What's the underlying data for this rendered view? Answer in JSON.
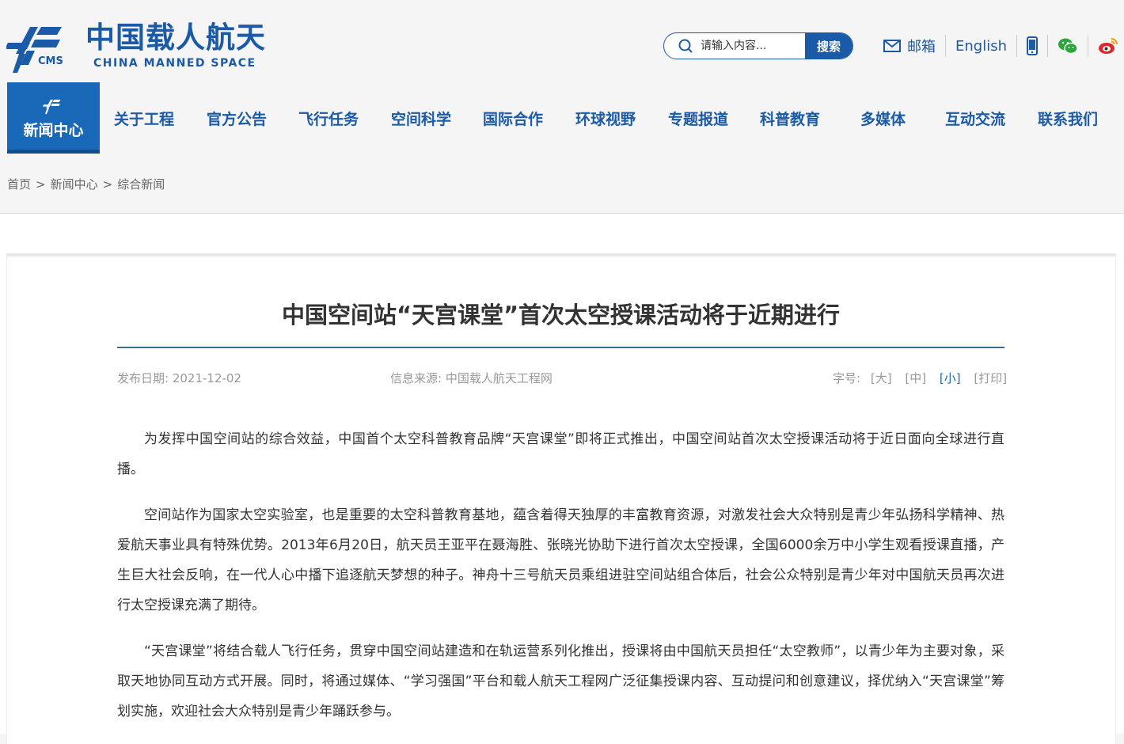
{
  "logo": {
    "cn": "中国载人航天",
    "en": "CHINA MANNED SPACE",
    "mark_text": "CMS"
  },
  "search": {
    "placeholder": "请输入内容...",
    "button": "搜索"
  },
  "tools": {
    "mail": "邮箱",
    "english": "English"
  },
  "nav": {
    "items": [
      {
        "label": "新闻中心",
        "active": true
      },
      {
        "label": "关于工程"
      },
      {
        "label": "官方公告"
      },
      {
        "label": "飞行任务"
      },
      {
        "label": "空间科学"
      },
      {
        "label": "国际合作"
      },
      {
        "label": "环球视野"
      },
      {
        "label": "专题报道"
      },
      {
        "label": "科普教育"
      },
      {
        "label": "多媒体"
      },
      {
        "label": "互动交流"
      },
      {
        "label": "联系我们"
      }
    ]
  },
  "breadcrumb": [
    "首页",
    "新闻中心",
    "综合新闻"
  ],
  "breadcrumb_sep": ">",
  "article": {
    "title": "中国空间站“天宫课堂”首次太空授课活动将于近期进行",
    "date": "发布日期: 2021-12-02",
    "source": "信息来源: 中国载人航天工程网",
    "font_size_label": "字号:",
    "font_sizes": [
      "[大]",
      "[中]",
      "[小]"
    ],
    "print": "[打印]",
    "paragraphs": [
      "为发挥中国空间站的综合效益，中国首个太空科普教育品牌“天宫课堂”即将正式推出，中国空间站首次太空授课活动将于近日面向全球进行直播。",
      "空间站作为国家太空实验室，也是重要的太空科普教育基地，蕴含着得天独厚的丰富教育资源，对激发社会大众特别是青少年弘扬科学精神、热爱航天事业具有特殊优势。2013年6月20日，航天员王亚平在聂海胜、张晓光协助下进行首次太空授课，全国6000余万中小学生观看授课直播，产生巨大社会反响，在一代人心中播下追逐航天梦想的种子。神舟十三号航天员乘组进驻空间站组合体后，社会公众特别是青少年对中国航天员再次进行太空授课充满了期待。",
      "“天宫课堂”将结合载人飞行任务，贯穿中国空间站建造和在轨运营系列化推出，授课将由中国航天员担任“太空教师”，以青少年为主要对象，采取天地协同互动方式开展。同时，将通过媒体、“学习强国”平台和载人航天工程网广泛征集授课内容、互动提问和创意建议，择优纳入“天宫课堂”筹划实施，欢迎社会大众特别是青少年踊跃参与。"
    ]
  },
  "colors": {
    "brand": "#1a5aa6",
    "nav_active": "#1a69b8",
    "title_rule": "#3a6f8e",
    "wechat": "#2aa63a",
    "weibo": "#e0262b"
  }
}
